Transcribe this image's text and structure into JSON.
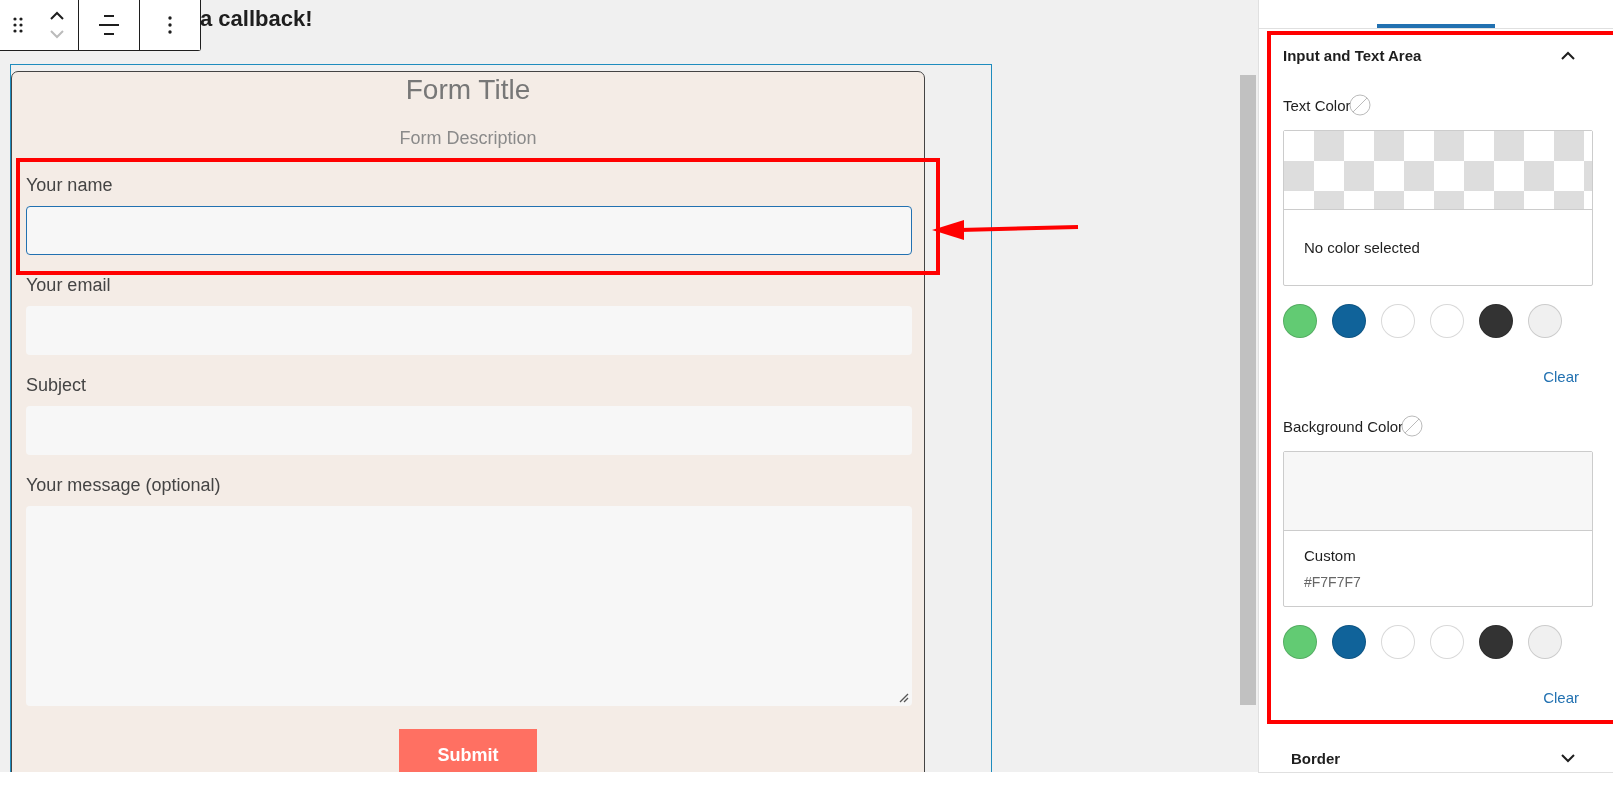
{
  "block_toolbar": {
    "buttons": [
      {
        "kind": "drag"
      },
      {
        "kind": "move"
      },
      {
        "kind": "align"
      },
      {
        "kind": "more"
      }
    ]
  },
  "heading": "a callback!",
  "form": {
    "title": "Form Title",
    "description": "Form Description",
    "fields": [
      {
        "label": "Your name",
        "kind": "input",
        "focused": true,
        "highlighted": true
      },
      {
        "label": "Your email",
        "kind": "input",
        "focused": false,
        "highlighted": false
      },
      {
        "label": "Subject",
        "kind": "input",
        "focused": false,
        "highlighted": false
      },
      {
        "label": "Your message (optional)",
        "kind": "textarea",
        "focused": false,
        "highlighted": false
      }
    ],
    "submit": "Submit"
  },
  "sidebar": {
    "tabs": [
      {
        "selected": false
      },
      {
        "selected": true
      },
      {
        "selected": false
      }
    ],
    "panels": [
      {
        "title": "Input and Text Area",
        "expanded": true,
        "highlighted": true,
        "settings": [
          {
            "label": "Text Color",
            "kind": "empty",
            "value_label": "No color selected",
            "clear": "Clear",
            "swatches": [
              {
                "color": "#62cb73"
              },
              {
                "color": "#10639a"
              },
              {
                "color": "#ffffff"
              },
              {
                "color": "#ffffff"
              },
              {
                "color": "#333333"
              },
              {
                "color": "#f0f0f0"
              }
            ]
          },
          {
            "label": "Background Color",
            "kind": "custom",
            "name": "Custom",
            "value": "#F7F7F7",
            "clear": "Clear",
            "swatches": [
              {
                "color": "#62cb73"
              },
              {
                "color": "#10639a"
              },
              {
                "color": "#ffffff"
              },
              {
                "color": "#ffffff"
              },
              {
                "color": "#333333"
              },
              {
                "color": "#f0f0f0"
              }
            ]
          }
        ]
      },
      {
        "title": "Border",
        "expanded": false,
        "highlighted": false
      }
    ]
  }
}
